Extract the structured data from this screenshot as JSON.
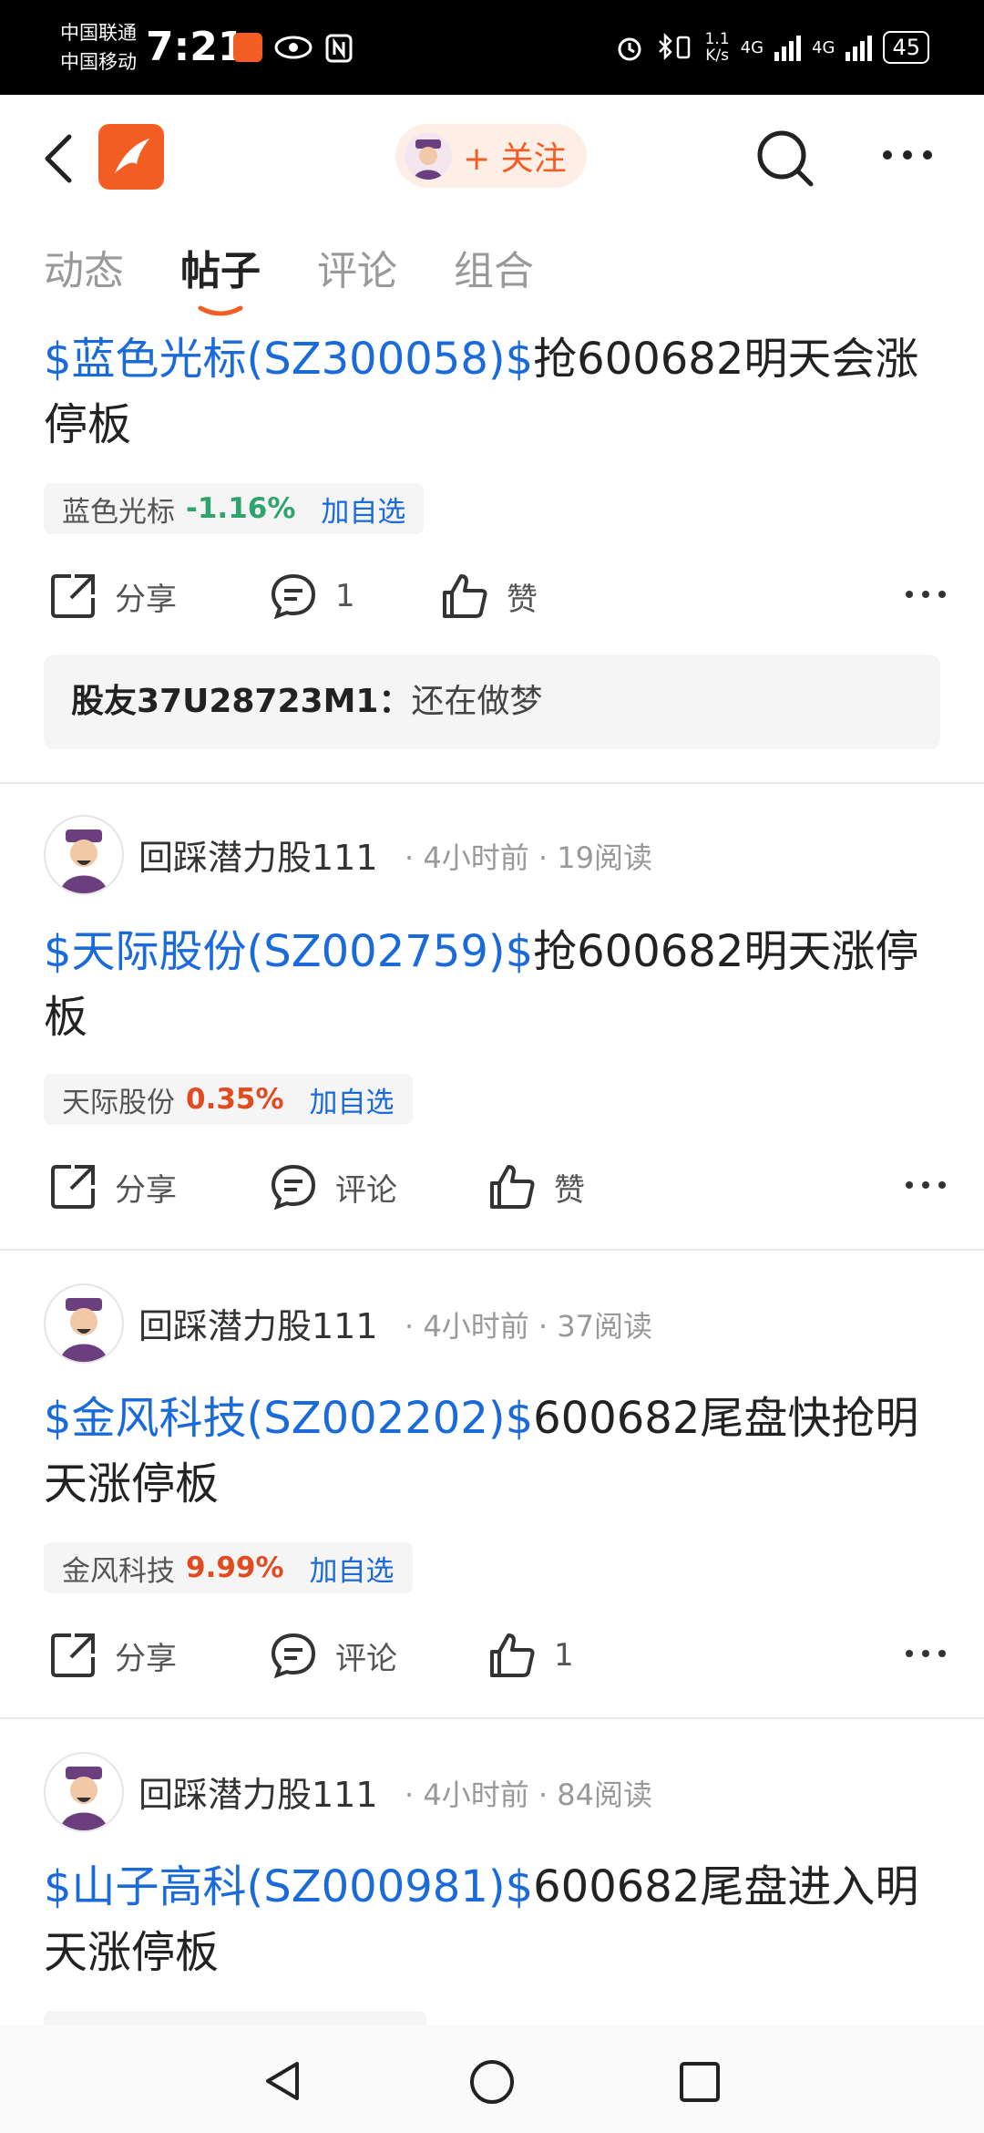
{
  "status_bar": {
    "carrier1": "中国联通",
    "carrier2": "中国移动",
    "time": "7:21",
    "speed_top": "1.1",
    "speed_bottom": "K/s",
    "net1": "4G",
    "net2": "4G",
    "battery": "45"
  },
  "header": {
    "follow_label": "+ 关注"
  },
  "tabs": [
    "动态",
    "帖子",
    "评论",
    "组合"
  ],
  "tab_active": "帖子",
  "posts": [
    {
      "stock_tag": "$蓝色光标(SZ300058)$",
      "body": "抢600682明天会涨停板",
      "chip": {
        "name": "蓝色光标",
        "change": "-1.16%",
        "add": "加自选"
      },
      "share": "分享",
      "comment": "1",
      "like": "赞",
      "reply_user": "股友37U28723M1",
      "reply_sep": "：",
      "reply_text": "还在做梦"
    },
    {
      "author": "回踩潜力股111",
      "meta": "· 4小时前 · 19阅读",
      "stock_tag": "$天际股份(SZ002759)$",
      "body": "抢600682明天涨停板",
      "chip": {
        "name": "天际股份",
        "change": "0.35%",
        "add": "加自选"
      },
      "share": "分享",
      "comment": "评论",
      "like": "赞"
    },
    {
      "author": "回踩潜力股111",
      "meta": "· 4小时前 · 37阅读",
      "stock_tag": "$金风科技(SZ002202)$",
      "body": "600682尾盘快抢明天涨停板",
      "chip": {
        "name": "金风科技",
        "change": "9.99%",
        "add": "加自选"
      },
      "share": "分享",
      "comment": "评论",
      "like": "1"
    },
    {
      "author": "回踩潜力股111",
      "meta": "· 4小时前 · 84阅读",
      "stock_tag": "$山子高科(SZ000981)$",
      "body": "600682尾盘进入明天涨停板"
    }
  ],
  "colors": {
    "accent": "#f25d24",
    "link": "#1a6ad9",
    "down": "#2ea36b",
    "up": "#e04b1f"
  },
  "icons": [
    "back-icon",
    "app-logo-icon",
    "search-icon",
    "more-icon",
    "share-icon",
    "comment-icon",
    "like-icon",
    "back-nav-icon",
    "home-nav-icon",
    "recents-nav-icon"
  ]
}
